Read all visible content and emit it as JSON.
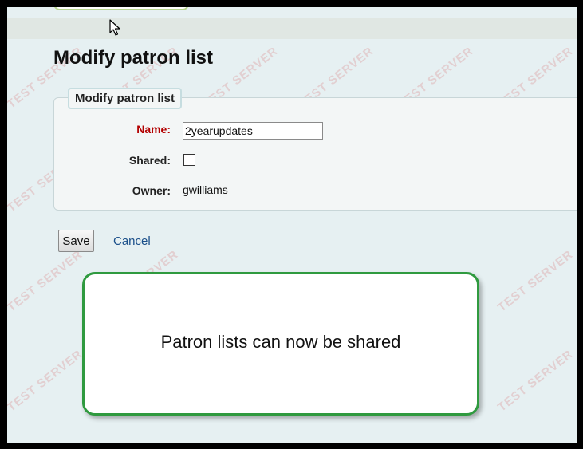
{
  "page": {
    "title": "Modify patron list",
    "legend": "Modify patron list"
  },
  "form": {
    "name_label": "Name:",
    "name_value": "2yearupdates",
    "shared_label": "Shared:",
    "shared_checked": false,
    "owner_label": "Owner:",
    "owner_value": "gwilliams"
  },
  "actions": {
    "save_label": "Save",
    "cancel_label": "Cancel"
  },
  "callout": {
    "text": "Patron lists can now be shared"
  },
  "watermark": {
    "text": "TEST SERVER"
  },
  "colors": {
    "required_label": "#b30000",
    "link": "#1a4f8a",
    "callout_border": "#2f9a3f"
  }
}
